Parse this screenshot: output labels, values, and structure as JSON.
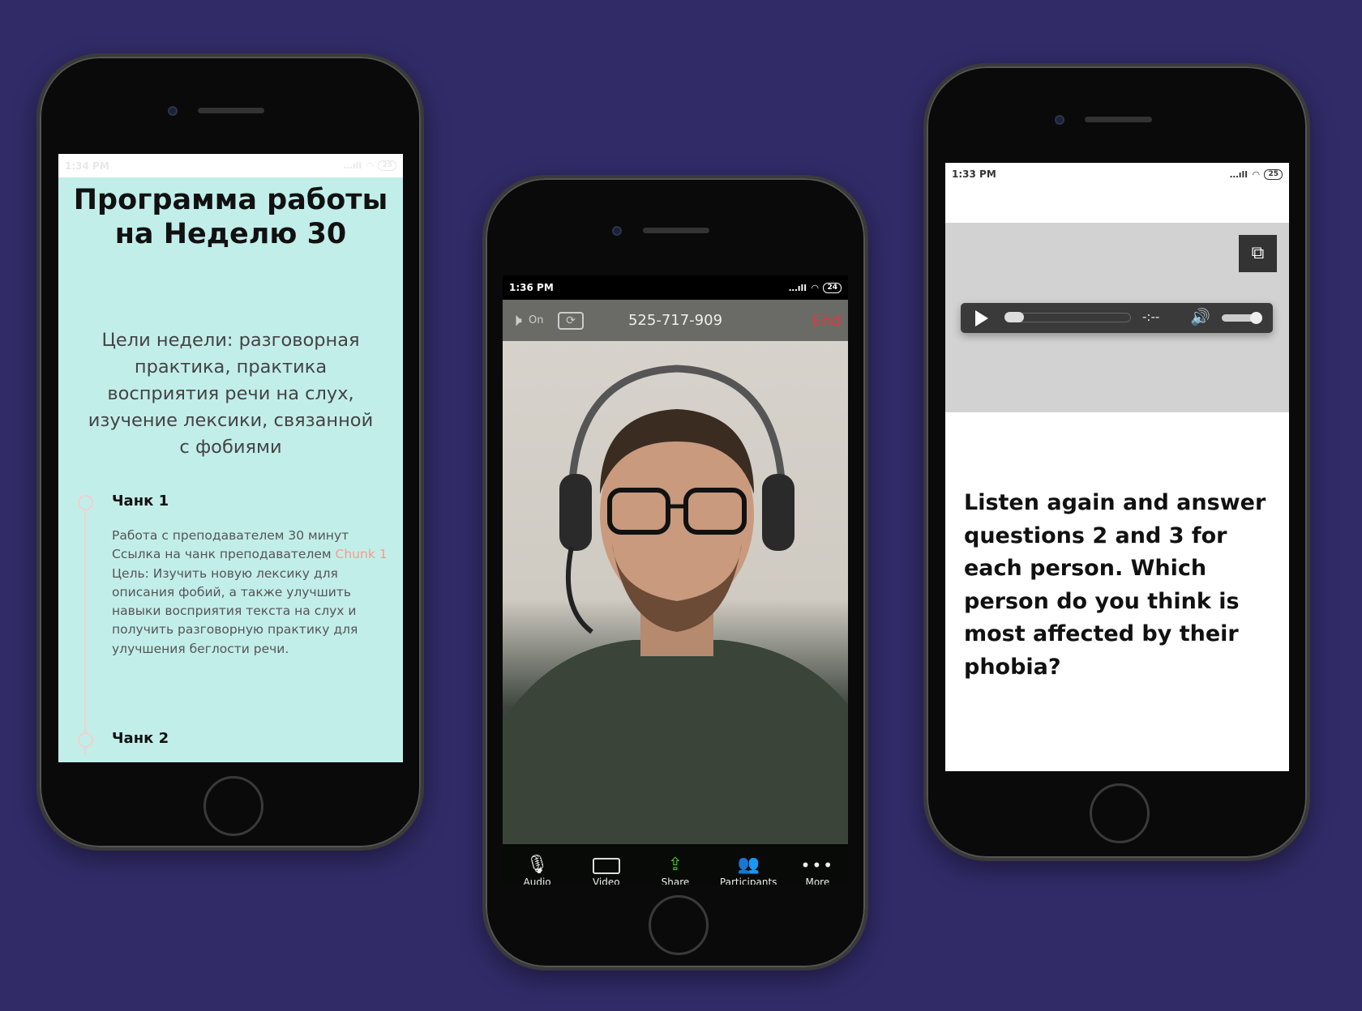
{
  "background_color": "#312b68",
  "left_phone": {
    "status": {
      "time": "1:34 PM",
      "battery": "25"
    },
    "title_line1": "Программа работы",
    "title_line2": "на Неделю 30",
    "goals": "Цели недели: разговорная практика, практика восприятия речи на слух, изучение лексики, связанной с фобиями",
    "chunks": [
      {
        "label": "Чанк 1",
        "line1": "Работа с преподавателем 30 минут",
        "line2_prefix": "Ссылка на чанк преподавателем ",
        "link": "Chunk 1",
        "goal": "Цель: Изучить новую лексику для описания фобий, а также улучшить навыки восприятия текста на слух и получить разговорную практику для улучшения беглости речи."
      },
      {
        "label": "Чанк 2"
      }
    ],
    "bg_color": "#c2eeea",
    "link_color": "#f0a08a"
  },
  "middle_phone": {
    "status": {
      "time": "1:36 PM",
      "battery": "24"
    },
    "speaker_label": "On",
    "meeting_id": "525-717-909",
    "end_label": "End",
    "toolbar": [
      {
        "label": "Audio",
        "icon": "microphone-icon"
      },
      {
        "label": "Video",
        "icon": "video-camera-icon"
      },
      {
        "label": "Share",
        "icon": "share-icon"
      },
      {
        "label": "Participants",
        "icon": "participants-icon"
      },
      {
        "label": "More",
        "icon": "more-icon"
      }
    ],
    "end_color": "#e8363a",
    "share_color": "#4cc52a"
  },
  "right_phone": {
    "status": {
      "time": "1:33 PM",
      "battery": "25"
    },
    "audio_player": {
      "time": "-:--",
      "progress": 0,
      "volume": 1.0
    },
    "question": "Listen again and answer questions 2 and 3 for each person. Which person do you think is most affected by their phobia?"
  }
}
